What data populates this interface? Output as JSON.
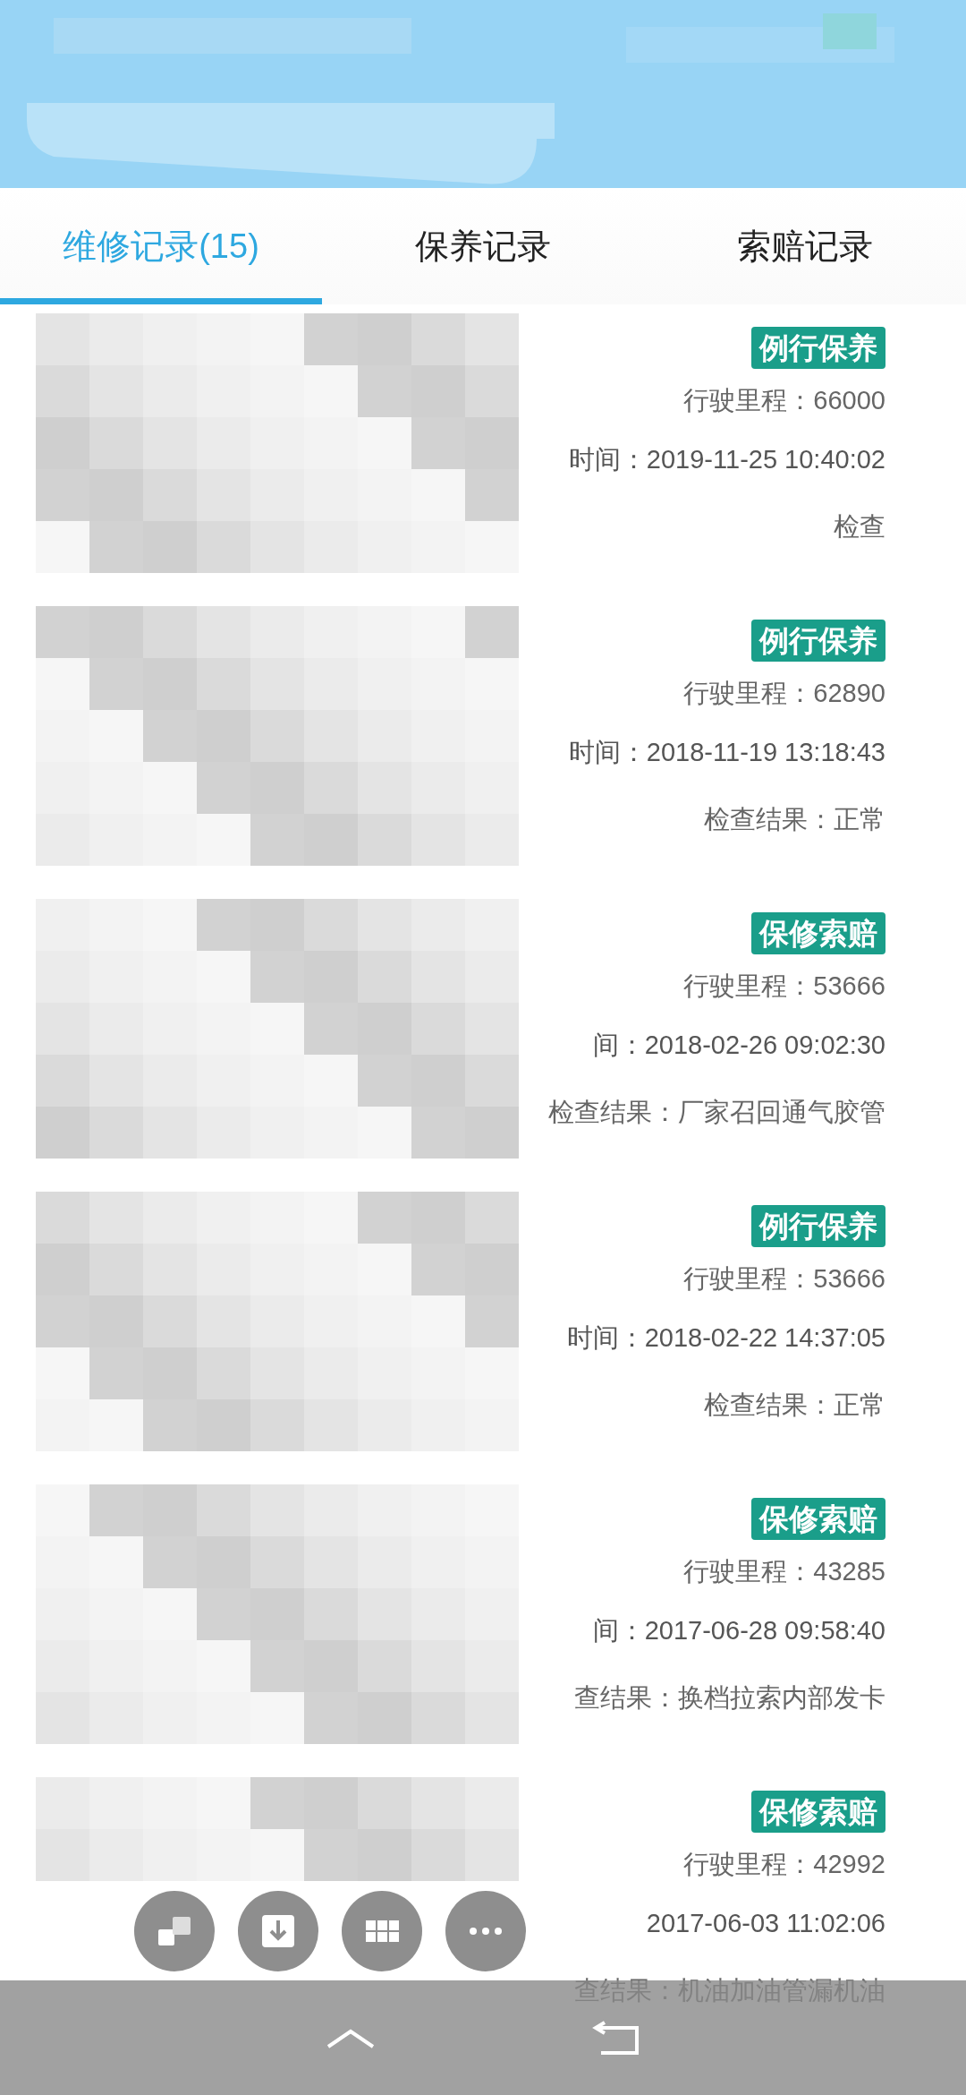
{
  "tabs": [
    {
      "label": "维修记录(15)",
      "selected": true
    },
    {
      "label": "保养记录",
      "selected": false
    },
    {
      "label": "索赔记录",
      "selected": false
    }
  ],
  "records": [
    {
      "badge": "例行保养",
      "mileage": "行驶里程：66000",
      "time": "时间：2019-11-25 10:40:02",
      "result": "检查"
    },
    {
      "badge": "例行保养",
      "mileage": "行驶里程：62890",
      "time": "时间：2018-11-19 13:18:43",
      "result": "检查结果：正常"
    },
    {
      "badge": "保修索赔",
      "mileage": "行驶里程：53666",
      "time": "间：2018-02-26 09:02:30",
      "result": "检查结果：厂家召回通气胶管"
    },
    {
      "badge": "例行保养",
      "mileage": "行驶里程：53666",
      "time": "时间：2018-02-22 14:37:05",
      "result": "检查结果：正常"
    },
    {
      "badge": "保修索赔",
      "mileage": "行驶里程：43285",
      "time": "间：2017-06-28 09:58:40",
      "result": "查结果：换档拉索内部发卡"
    },
    {
      "badge": "保修索赔",
      "mileage": "行驶里程：42992",
      "time": "2017-06-03 11:02:06",
      "result": "查结果：机油加油管漏机油"
    }
  ]
}
